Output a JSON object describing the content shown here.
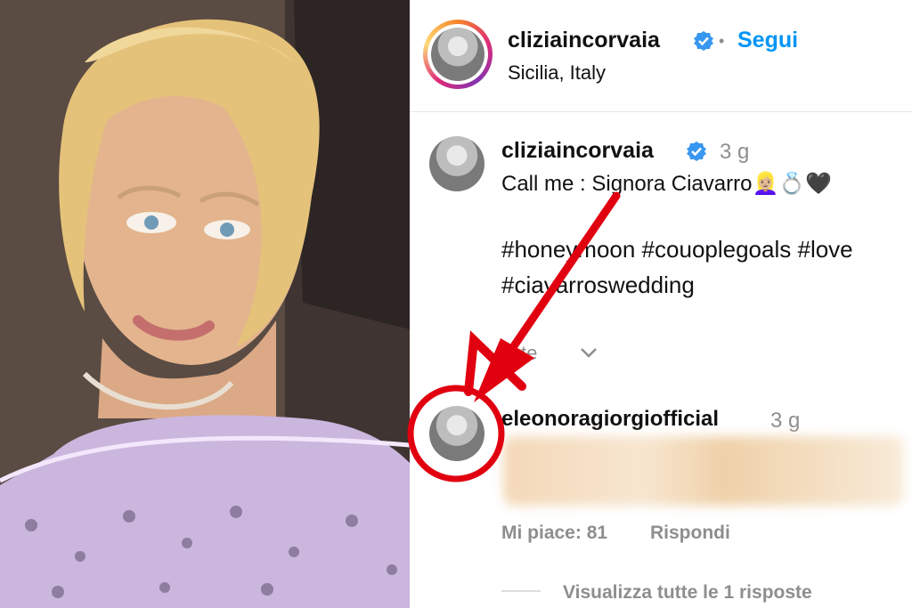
{
  "header": {
    "username": "cliziaincorvaia",
    "separator": "•",
    "follow_label": "Segui",
    "location": "Sicilia, Italy"
  },
  "post": {
    "username": "cliziaincorvaia",
    "time": "3 g",
    "caption": "Call me : Signora Ciavarro👱🏼‍♀️💍🖤",
    "hashtags_line1": "#honeymoon #couoplegoals #love",
    "hashtags_line2": "#ciavarroswedding",
    "translate": "Vedi traduzione",
    "more_icon": "chevron-down-icon",
    "translate_partial": "D   te"
  },
  "comment": {
    "username": "eleonoragiorgiofficial",
    "time": "3 g",
    "likes": "Mi piace: 81",
    "reply": "Rispondi",
    "view_replies": "Visualizza tutte le 1 risposte"
  },
  "colors": {
    "annotation_red": "#e10010",
    "link_blue": "#0095f6",
    "hashtag_blue": "#1e3f73"
  }
}
